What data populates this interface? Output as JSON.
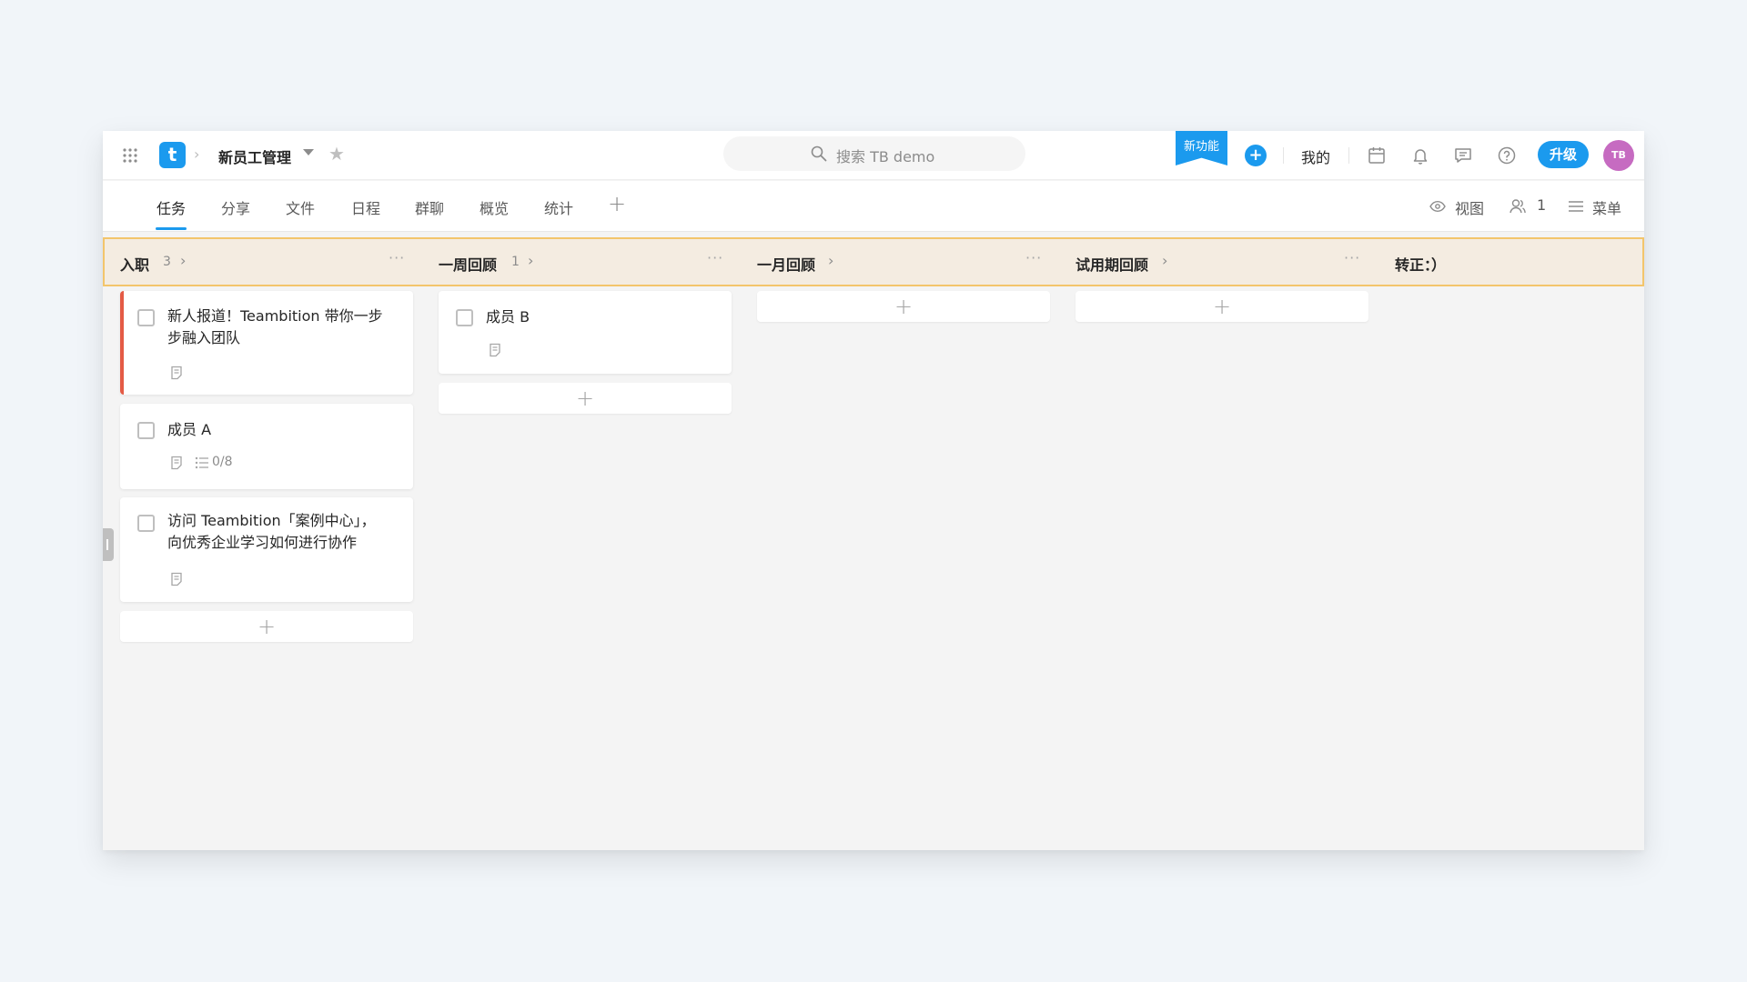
{
  "header": {
    "project_title": "新员工管理",
    "crumb_sep": "›",
    "logo_letter": "t",
    "search_placeholder": "搜索 TB demo",
    "new_feature": "新功能",
    "add_symbol": "+",
    "mine": "我的",
    "upgrade": "升级",
    "avatar_initials": "TB"
  },
  "tabs": [
    {
      "label": "任务",
      "active": true
    },
    {
      "label": "分享"
    },
    {
      "label": "文件"
    },
    {
      "label": "日程"
    },
    {
      "label": "群聊"
    },
    {
      "label": "概览"
    },
    {
      "label": "统计"
    }
  ],
  "tab_add": "+",
  "toolbar": {
    "view": "视图",
    "members_count": "1",
    "menu": "菜单"
  },
  "columns": [
    {
      "name": "入职",
      "count": "3",
      "arrow": "›",
      "more": "···"
    },
    {
      "name": "一周回顾",
      "count": "1",
      "arrow": "›",
      "more": "···"
    },
    {
      "name": "一月回顾",
      "arrow": "›",
      "more": "···"
    },
    {
      "name": "试用期回顾",
      "arrow": "›",
      "more": "···"
    },
    {
      "name": "转正：）"
    }
  ],
  "cards": {
    "onboarding_1": {
      "title_line1": "新人报道！Teambition 带你一步",
      "title_line2": "步融入团队"
    },
    "onboarding_2": {
      "title": "成员 A",
      "subtasks": "0/8"
    },
    "onboarding_3": {
      "title_line1": "访问 Teambition「案例中心」，",
      "title_line2": "向优秀企业学习如何进行协作"
    },
    "week_1": {
      "title": "成员 B"
    }
  },
  "add_card_symbol": "+",
  "colors": {
    "accent": "#1b9aee",
    "header_strip": "#f4ece1",
    "header_border": "#f3c56b",
    "card_priority": "#e45b45",
    "avatar": "#c66bc1"
  }
}
